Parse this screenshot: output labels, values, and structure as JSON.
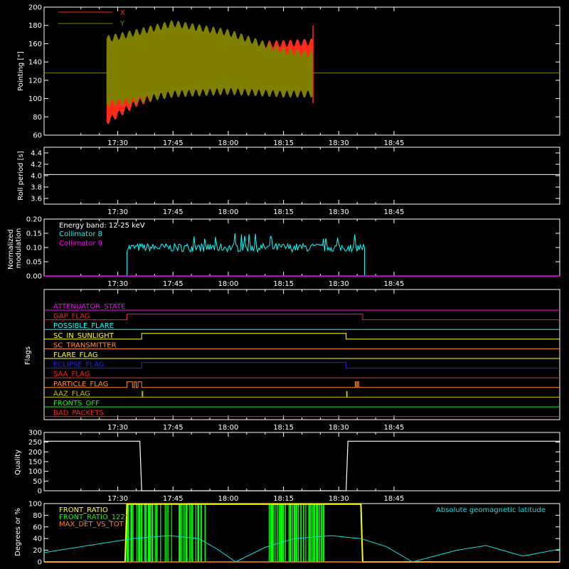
{
  "colors": {
    "background": "#000000",
    "axes": "#ffffff",
    "pointing_x": "#ff2a1a",
    "pointing_y": "#808000",
    "roll": "#ffffff",
    "collimator8": "#00ffff",
    "collimator9": "#ff00ff",
    "quality": "#ffffff",
    "front_ratio": "#ffff00",
    "front_ratio_1225": "#00ff00",
    "max_det_vs_tot": "#ff7f24",
    "geomag": "#00e5e5"
  },
  "time_axis": {
    "start_min": 1510,
    "end_min": 1650,
    "ticks": [
      {
        "t": 1530,
        "label": "17:30"
      },
      {
        "t": 1545,
        "label": "17:45"
      },
      {
        "t": 1560,
        "label": "18:00"
      },
      {
        "t": 1575,
        "label": "18:15"
      },
      {
        "t": 1590,
        "label": "18:30"
      },
      {
        "t": 1605,
        "label": "18:45"
      }
    ]
  },
  "chart_data": [
    {
      "id": "pointing",
      "type": "area",
      "ylabel": "Pointing [\"]",
      "ylim": [
        60,
        200
      ],
      "yticks": [
        60,
        80,
        100,
        120,
        140,
        160,
        180,
        200
      ],
      "legend": {
        "placement": "top-left",
        "entries": [
          "X",
          "Y"
        ]
      },
      "baseline": 128,
      "start": 1527,
      "end": 1583,
      "series": [
        {
          "name": "X",
          "time": [
            1527,
            1535,
            1545,
            1560,
            1575,
            1583
          ],
          "upper": [
            150,
            152,
            156,
            158,
            160,
            162
          ],
          "lower": [
            75,
            95,
            108,
            115,
            118,
            118
          ]
        },
        {
          "name": "Y",
          "time": [
            1527,
            1535,
            1545,
            1560,
            1575,
            1583
          ],
          "upper": [
            165,
            172,
            182,
            172,
            152,
            148
          ],
          "lower": [
            95,
            98,
            105,
            108,
            105,
            105
          ]
        }
      ]
    },
    {
      "id": "roll",
      "type": "line",
      "ylabel": "Roll period [s]",
      "ylim": [
        3.5,
        4.5
      ],
      "yticks": [
        3.6,
        3.8,
        4.0,
        4.2,
        4.4
      ],
      "yticklabels": [
        "3.6",
        "3.8",
        "4.0",
        "4.2",
        "4.4"
      ],
      "series": [
        {
          "name": "",
          "time": [
            1510,
            1650
          ],
          "values": [
            4.02,
            4.02
          ]
        }
      ]
    },
    {
      "id": "modulation",
      "type": "bar",
      "ylabel": "Normalized modulation",
      "ylabel_lines": [
        "Normalized",
        "modulation"
      ],
      "ylim": [
        0,
        0.2
      ],
      "yticks": [
        0,
        0.05,
        0.1,
        0.15,
        0.2
      ],
      "yticklabels": [
        "0.00",
        "0.05",
        "0.10",
        "0.15",
        "0.20"
      ],
      "legend": {
        "placement": "top-left",
        "entries": [
          "Energy band: 12-25 keV",
          "Collimator 8",
          "Collimator 9"
        ]
      },
      "series": [
        {
          "name": "Collimator 8",
          "time_start": 1532.5,
          "time_end": 1597,
          "typical": 0.1,
          "range": [
            0.08,
            0.15
          ]
        },
        {
          "name": "Collimator 9",
          "values": [
            0,
            0
          ]
        }
      ]
    },
    {
      "id": "flags",
      "type": "line",
      "ylabel": "Flags",
      "series": [
        {
          "name": "ATTENUATOR_STATE",
          "color": "#ff00ff",
          "transitions": []
        },
        {
          "name": "GAP_FLAG",
          "color": "#ff2020",
          "transitions": [
            1532.5,
            1596.5
          ]
        },
        {
          "name": "POSSIBLE_FLARE",
          "color": "#00ffff",
          "transitions": []
        },
        {
          "name": "SC_IN_SUNLIGHT",
          "color": "#ffff00",
          "transitions": [
            1536.5,
            1592
          ]
        },
        {
          "name": "SC_TRANSMITTER",
          "color": "#ff8c2a",
          "transitions": []
        },
        {
          "name": "FLARE_FLAG",
          "color": "#ffff00",
          "transitions": []
        },
        {
          "name": "ECLIPSE_FLAG",
          "color": "#2020ff",
          "transitions": [
            1536.5,
            1592
          ]
        },
        {
          "name": "SAA_FLAG",
          "color": "#ff2020",
          "transitions": []
        },
        {
          "name": "PARTICLE_FLAG",
          "color": "#ff8c2a",
          "transitions": [
            1532.5,
            1534,
            1534.5,
            1535,
            1535.5,
            1536.5,
            1594.5,
            1594.8,
            1595.1,
            1595.4
          ]
        },
        {
          "name": "AAZ_FLAG",
          "color": "#c0c000",
          "transitions": [
            1536.6,
            1536.8,
            1592.1,
            1592.3
          ]
        },
        {
          "name": "FRONTS_OFF",
          "color": "#00ff00",
          "transitions": []
        },
        {
          "name": "BAD_PACKETS",
          "color": "#ff2020",
          "transitions": []
        }
      ]
    },
    {
      "id": "quality",
      "type": "line",
      "ylabel": "Quality",
      "ylim": [
        0,
        300
      ],
      "yticks": [
        0,
        50,
        100,
        150,
        200,
        250,
        300
      ],
      "series": [
        {
          "name": "",
          "time": [
            1510,
            1536,
            1536.5,
            1592,
            1592.5,
            1650
          ],
          "values": [
            255,
            255,
            0,
            0,
            255,
            255
          ]
        }
      ]
    },
    {
      "id": "geo",
      "type": "line",
      "ylabel": "Degrees or %",
      "ylim": [
        0,
        100
      ],
      "yticks": [
        0,
        20,
        40,
        60,
        80,
        100
      ],
      "legend": {
        "placement": "top-left",
        "entries": [
          "FRONT_RATIO",
          "FRONT_RATIO_1225",
          "MAX_DET_VS_TOT"
        ],
        "right_entry": "Absolute geomagnetic latitude"
      },
      "series": [
        {
          "name": "Absolute geomagnetic latitude",
          "time": [
            1510,
            1522,
            1534,
            1544,
            1552,
            1557,
            1562,
            1570,
            1578,
            1588,
            1596,
            1603,
            1610,
            1622,
            1630,
            1640,
            1650
          ],
          "values": [
            16,
            28,
            40,
            45,
            40,
            22,
            0,
            25,
            40,
            45,
            40,
            26,
            0,
            20,
            28,
            10,
            22
          ]
        },
        {
          "name": "FRONT_RATIO",
          "time": [
            1510,
            1532,
            1532.5,
            1596,
            1596.5,
            1650
          ],
          "values": [
            0,
            0,
            100,
            100,
            0,
            0
          ]
        },
        {
          "name": "FRONT_RATIO_1225",
          "bursts": [
            [
              1532.5,
              1554
            ],
            [
              1571,
              1586
            ]
          ]
        },
        {
          "name": "MAX_DET_VS_TOT",
          "time": [
            1510,
            1650
          ],
          "values": [
            0,
            0
          ]
        }
      ]
    }
  ]
}
